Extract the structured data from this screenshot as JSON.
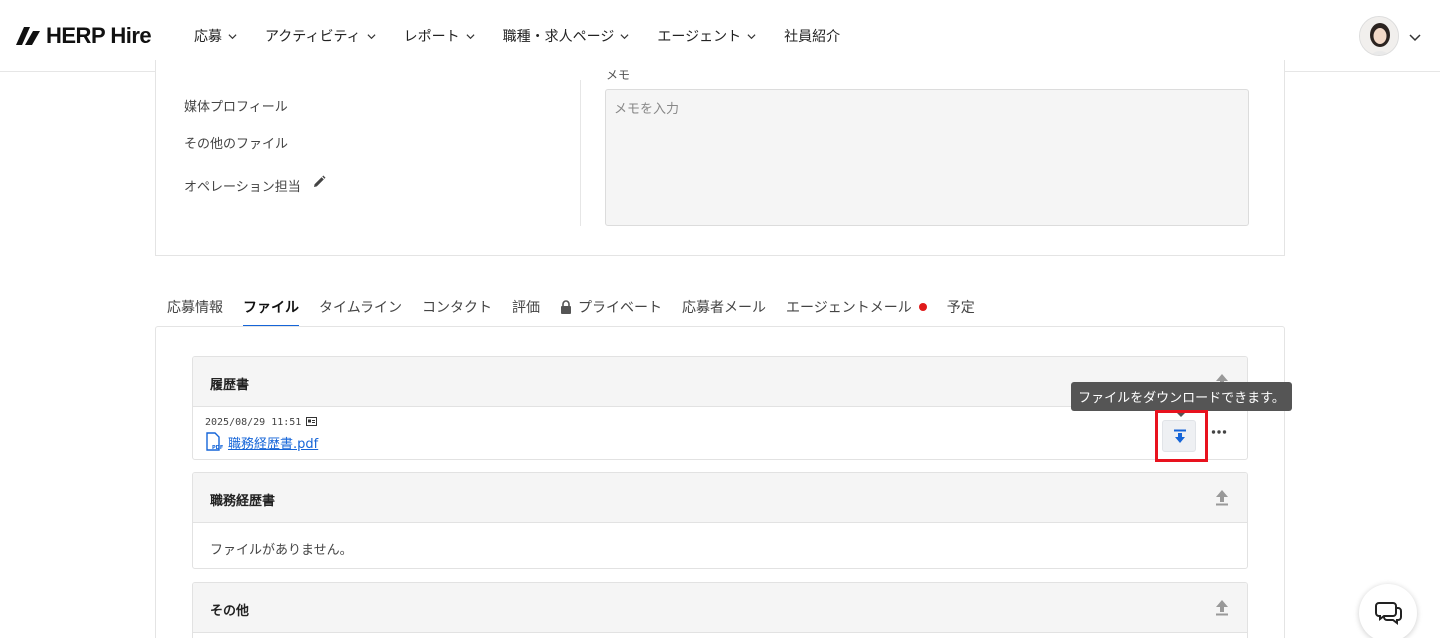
{
  "brand": {
    "name": "HERP Hire"
  },
  "nav": {
    "items": [
      {
        "label": "応募",
        "has_menu": true,
        "active": true
      },
      {
        "label": "アクティビティ",
        "has_menu": true,
        "active": false
      },
      {
        "label": "レポート",
        "has_menu": true,
        "active": false
      },
      {
        "label": "職種・求人ページ",
        "has_menu": true,
        "active": false
      },
      {
        "label": "エージェント",
        "has_menu": true,
        "active": false
      },
      {
        "label": "社員紹介",
        "has_menu": false,
        "active": false
      }
    ]
  },
  "profile": {
    "fields": [
      "媒体プロフィール",
      "その他のファイル",
      "オペレーション担当"
    ],
    "memo_label": "メモ",
    "memo_placeholder": "メモを入力"
  },
  "tabs": [
    {
      "label": "応募情報",
      "active": false
    },
    {
      "label": "ファイル",
      "active": true
    },
    {
      "label": "タイムライン",
      "active": false
    },
    {
      "label": "コンタクト",
      "active": false
    },
    {
      "label": "評価",
      "active": false
    },
    {
      "label": "プライベート",
      "active": false,
      "icon": "lock-icon"
    },
    {
      "label": "応募者メール",
      "active": false
    },
    {
      "label": "エージェントメール",
      "active": false,
      "notification": true
    },
    {
      "label": "予定",
      "active": false
    }
  ],
  "files": {
    "sections": [
      {
        "title": "履歴書",
        "file": {
          "date": "2025/08/29 11:51",
          "name": "職務経歴書.pdf"
        }
      },
      {
        "title": "職務経歴書",
        "empty_text": "ファイルがありません。"
      },
      {
        "title": "その他"
      }
    ],
    "tooltip": "ファイルをダウンロードできます。"
  },
  "colors": {
    "accent": "#1565d8",
    "highlight": "#e8121e",
    "notification": "#e01a1a"
  }
}
